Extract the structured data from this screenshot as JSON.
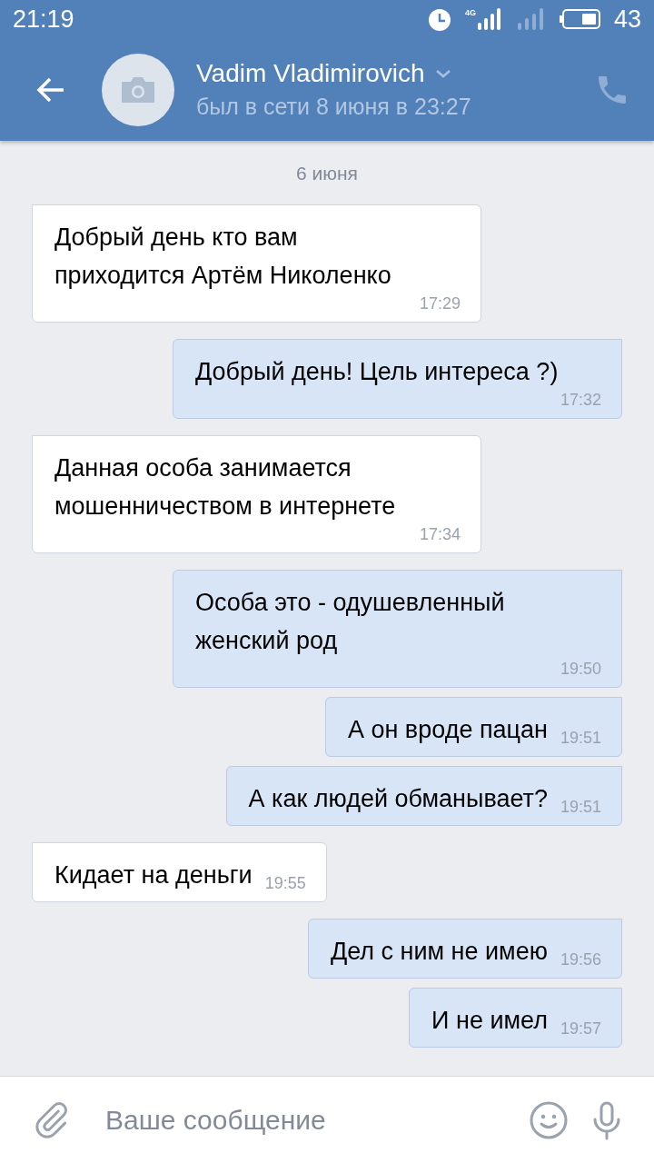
{
  "status_bar": {
    "time": "21:19",
    "network": "4G",
    "battery": "43"
  },
  "header": {
    "name": "Vadim Vladimirovich",
    "status": "был в сети 8 июня в 23:27"
  },
  "date_divider": "6 июня",
  "messages": [
    {
      "kind": "received",
      "text": "Добрый день кто вам приходится Артём Николенко",
      "time": "17:29"
    },
    {
      "kind": "sent",
      "text": "Добрый день! Цель интереса ?)",
      "time": "17:32"
    },
    {
      "kind": "received",
      "text": "Данная особа занимается мошенничеством в интернете",
      "time": "17:34"
    },
    {
      "kind": "sent",
      "text": "Особа это - одушевленный женский род",
      "time": "19:50"
    },
    {
      "kind": "sent",
      "text": "А он вроде пацан",
      "time": "19:51"
    },
    {
      "kind": "sent",
      "text": "А как людей обманывает?",
      "time": "19:51"
    },
    {
      "kind": "received",
      "text": "Кидает на деньги",
      "time": "19:55"
    },
    {
      "kind": "sent",
      "text": "Дел с ним не имею",
      "time": "19:56"
    },
    {
      "kind": "sent",
      "text": "И не имел",
      "time": "19:57"
    }
  ],
  "composer": {
    "placeholder": "Ваше сообщение"
  }
}
